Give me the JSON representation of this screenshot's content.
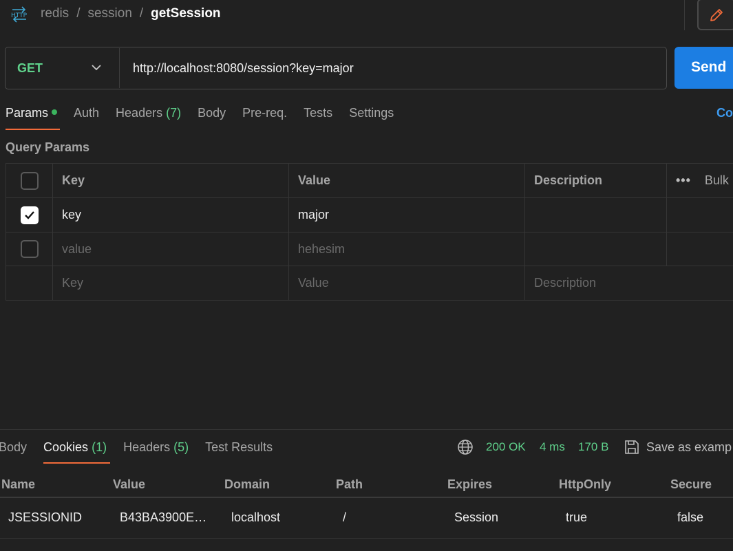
{
  "breadcrumb": {
    "items": [
      "redis",
      "session"
    ],
    "separator": "/",
    "current": "getSession",
    "icon": "http-icon"
  },
  "request": {
    "method": "GET",
    "url": "http://localhost:8080/session?key=major",
    "send_label": "Send"
  },
  "request_tabs": [
    {
      "label": "Params",
      "count": "",
      "active": true,
      "has_dot": true
    },
    {
      "label": "Auth",
      "count": ""
    },
    {
      "label": "Headers",
      "count": "(7)"
    },
    {
      "label": "Body",
      "count": ""
    },
    {
      "label": "Pre-req.",
      "count": ""
    },
    {
      "label": "Tests",
      "count": ""
    },
    {
      "label": "Settings",
      "count": ""
    }
  ],
  "cookies_link": "Co",
  "query_params": {
    "title": "Query Params",
    "headers": {
      "key": "Key",
      "value": "Value",
      "description": "Description",
      "bulk": "Bulk"
    },
    "rows": [
      {
        "checked": true,
        "key": "key",
        "value": "major",
        "description": "",
        "placeholder": false
      },
      {
        "checked": false,
        "key": "value",
        "value": "hehesim",
        "description": "",
        "placeholder": true
      }
    ],
    "new_row": {
      "key": "Key",
      "value": "Value",
      "description": "Description"
    }
  },
  "response": {
    "tabs": [
      {
        "label": "Body",
        "count": ""
      },
      {
        "label": "Cookies",
        "count": "(1)",
        "active": true
      },
      {
        "label": "Headers",
        "count": "(5)"
      },
      {
        "label": "Test Results",
        "count": ""
      }
    ],
    "status": "200 OK",
    "time": "4 ms",
    "size": "170 B",
    "save_label": "Save as examp",
    "cookie_headers": [
      "Name",
      "Value",
      "Domain",
      "Path",
      "Expires",
      "HttpOnly",
      "Secure"
    ],
    "cookies": [
      {
        "name": "JSESSIONID",
        "value": "B43BA3900E…",
        "domain": "localhost",
        "path": "/",
        "expires": "Session",
        "httponly": "true",
        "secure": "false"
      }
    ]
  },
  "colors": {
    "accent": "#f26b3a",
    "send": "#1c7ee3",
    "success": "#5fd18b",
    "link": "#3d9bf0"
  }
}
